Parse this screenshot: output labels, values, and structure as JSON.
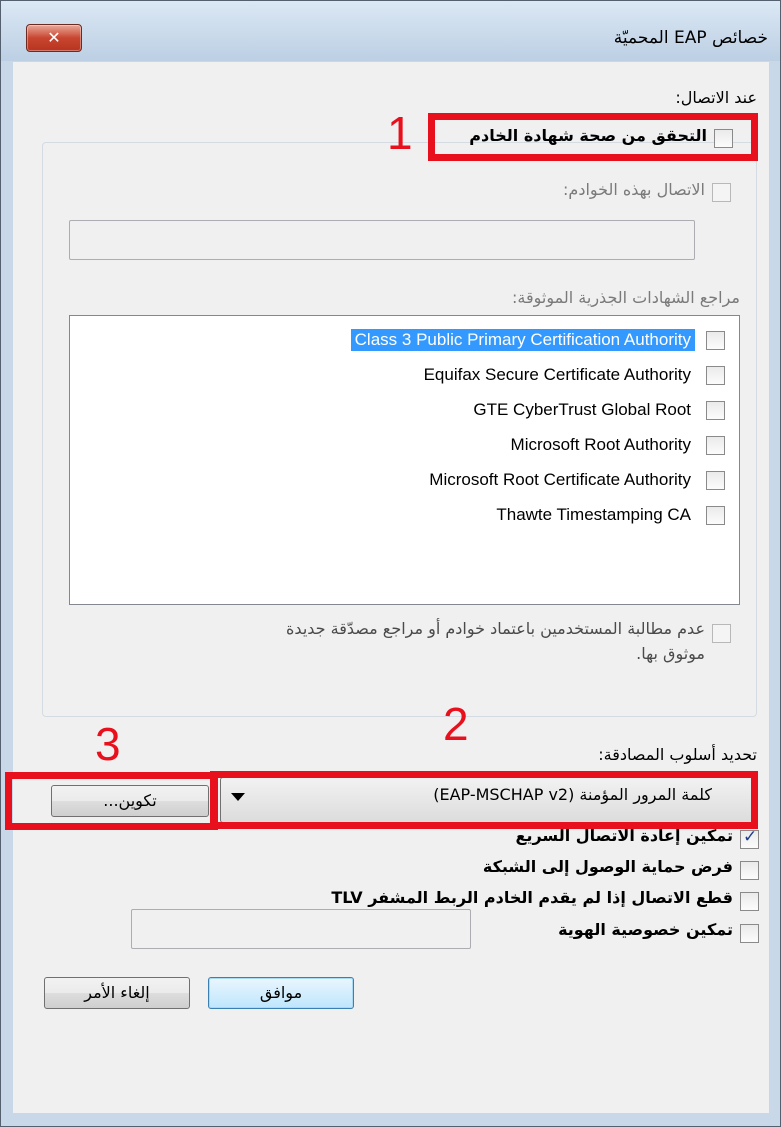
{
  "window": {
    "title": "خصائص EAP المحميّة",
    "close_label": "✕"
  },
  "connect_section": {
    "heading": "عند الاتصال:",
    "validate_cert": {
      "label": "التحقق من صحة شهادة الخادم",
      "checked": false
    },
    "connect_servers": {
      "label": "الاتصال بهذه الخوادم:",
      "checked": false,
      "value": ""
    },
    "trusted_ca_label": "مراجع الشهادات الجذرية الموثوقة:",
    "certificates": [
      {
        "label": "Class 3 Public Primary Certification Authority",
        "checked": false,
        "selected": true
      },
      {
        "label": "Equifax Secure Certificate Authority",
        "checked": false,
        "selected": false
      },
      {
        "label": "GTE CyberTrust Global Root",
        "checked": false,
        "selected": false
      },
      {
        "label": "Microsoft Root Authority",
        "checked": false,
        "selected": false
      },
      {
        "label": "Microsoft Root Certificate Authority",
        "checked": false,
        "selected": false
      },
      {
        "label": "Thawte Timestamping CA",
        "checked": false,
        "selected": false
      }
    ],
    "no_prompt": {
      "line1": "عدم مطالبة المستخدمين باعتماد خوادم أو مراجع مصدّقة جديدة",
      "line2": "موثوق بها.",
      "checked": false
    }
  },
  "auth": {
    "heading": "تحديد أسلوب المصادقة:",
    "method": "كلمة المرور المؤمنة (EAP-MSCHAP v2)",
    "configure_label": "تكوين..."
  },
  "options": [
    {
      "label": "تمكين إعادة الاتصال السريع",
      "checked": true
    },
    {
      "label": "فرض حماية الوصول إلى الشبكة",
      "checked": false
    },
    {
      "label": "قطع الاتصال إذا لم يقدم الخادم الربط المشفر TLV",
      "checked": false
    },
    {
      "label": "تمكين خصوصية الهوية",
      "checked": false,
      "value": ""
    }
  ],
  "buttons": {
    "ok": "موافق",
    "cancel": "إلغاء الأمر"
  },
  "annotations": {
    "one": "1",
    "two": "2",
    "three": "3"
  },
  "colors": {
    "highlight": "#e8101c",
    "selection": "#3399ff"
  }
}
